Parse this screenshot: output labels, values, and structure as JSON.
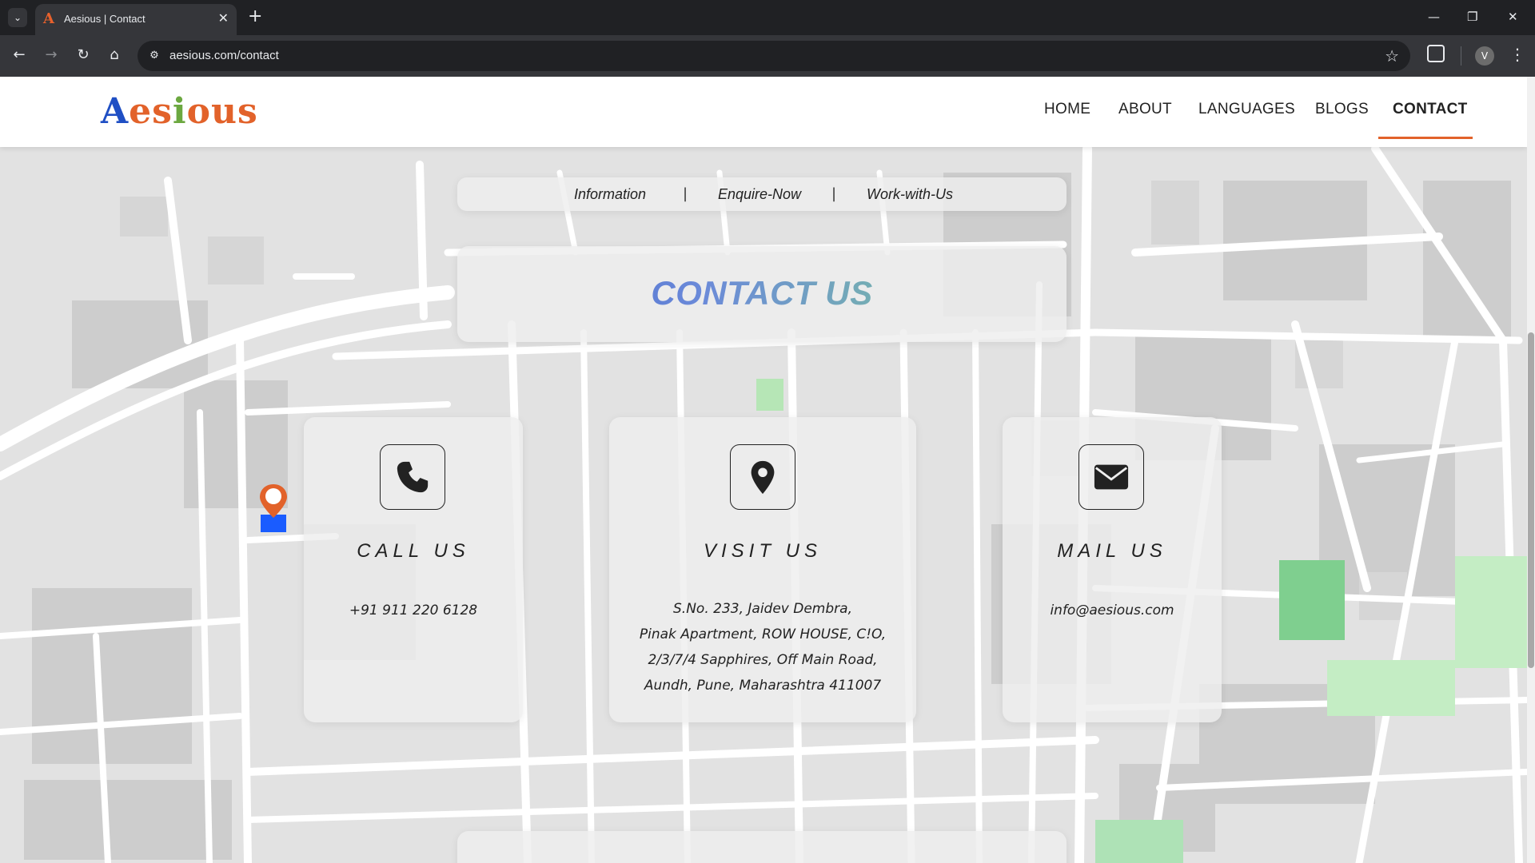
{
  "browser": {
    "tab_title": "Aesious | Contact",
    "favicon_letter": "A",
    "tab_close": "✕",
    "new_tab": "+",
    "url": "aesious.com/contact",
    "profile_initial": "V",
    "window_controls": {
      "minimize": "—",
      "restore": "❐",
      "close": "✕"
    }
  },
  "header": {
    "logo": {
      "a": "A",
      "e": "e",
      "s": "s",
      "i": "i",
      "ous": "ous"
    },
    "nav": [
      {
        "label": "HOME"
      },
      {
        "label": "ABOUT"
      },
      {
        "label": "LANGUAGES"
      },
      {
        "label": "BLOGS"
      },
      {
        "label": "CONTACT",
        "active": true
      }
    ]
  },
  "subnav": {
    "items": [
      "Information",
      "Enquire-Now",
      "Work-with-Us"
    ],
    "separator": "|"
  },
  "hero": {
    "title": "CONTACT US"
  },
  "cards": {
    "call": {
      "title": "CALL US",
      "icon": "phone-icon",
      "text": "+91 911 220 6128"
    },
    "visit": {
      "title": "VISIT US",
      "icon": "map-marker-icon",
      "lines": [
        "S.No. 233, Jaidev Dembra,",
        "Pinak Apartment, ROW HOUSE, C!O,",
        "2/3/7/4 Sapphires, Off Main Road,",
        "Aundh, Pune, Maharashtra 411007"
      ]
    },
    "mail": {
      "title": "MAIL US",
      "icon": "envelope-icon",
      "text": "info@aesious.com"
    }
  },
  "colors": {
    "accent_orange": "#e2622a",
    "logo_blue": "#1f4fc4",
    "card_glass": "#eeeeee",
    "map_road": "#ffffff",
    "map_block": "#c8c8c8",
    "map_park": "#b4ebb4"
  }
}
